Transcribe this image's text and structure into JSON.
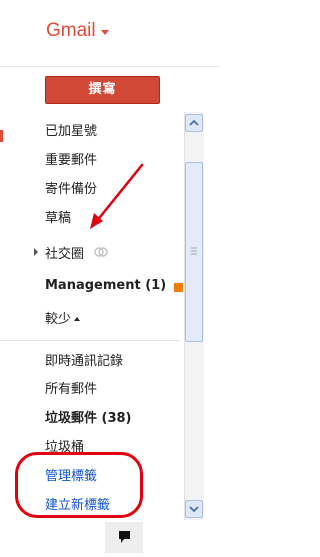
{
  "header": {
    "brand": "Gmail"
  },
  "compose": {
    "label": "撰寫"
  },
  "labels": {
    "starred": "已加星號",
    "important": "重要郵件",
    "sent": "寄件備份",
    "drafts": "草稿",
    "circles": "社交圈",
    "management": "Management (1)",
    "less": "較少"
  },
  "more_labels": {
    "chats": "即時通訊記錄",
    "all_mail": "所有郵件",
    "spam": "垃圾郵件 (38)",
    "trash": "垃圾桶",
    "manage_labels": "管理標籤",
    "create_label": "建立新標籤"
  },
  "colors": {
    "brand": "#dd4b39",
    "compose_bg": "#d14836",
    "annotation": "#e0000e",
    "link": "#1155cc",
    "label_swatch": "#f57c00"
  },
  "icons": {
    "brand_caret": "chevron-down-icon",
    "expand": "triangle-right-icon",
    "circles": "circles-icon",
    "collapse": "triangle-up-icon",
    "chat": "chat-bubble-icon"
  }
}
